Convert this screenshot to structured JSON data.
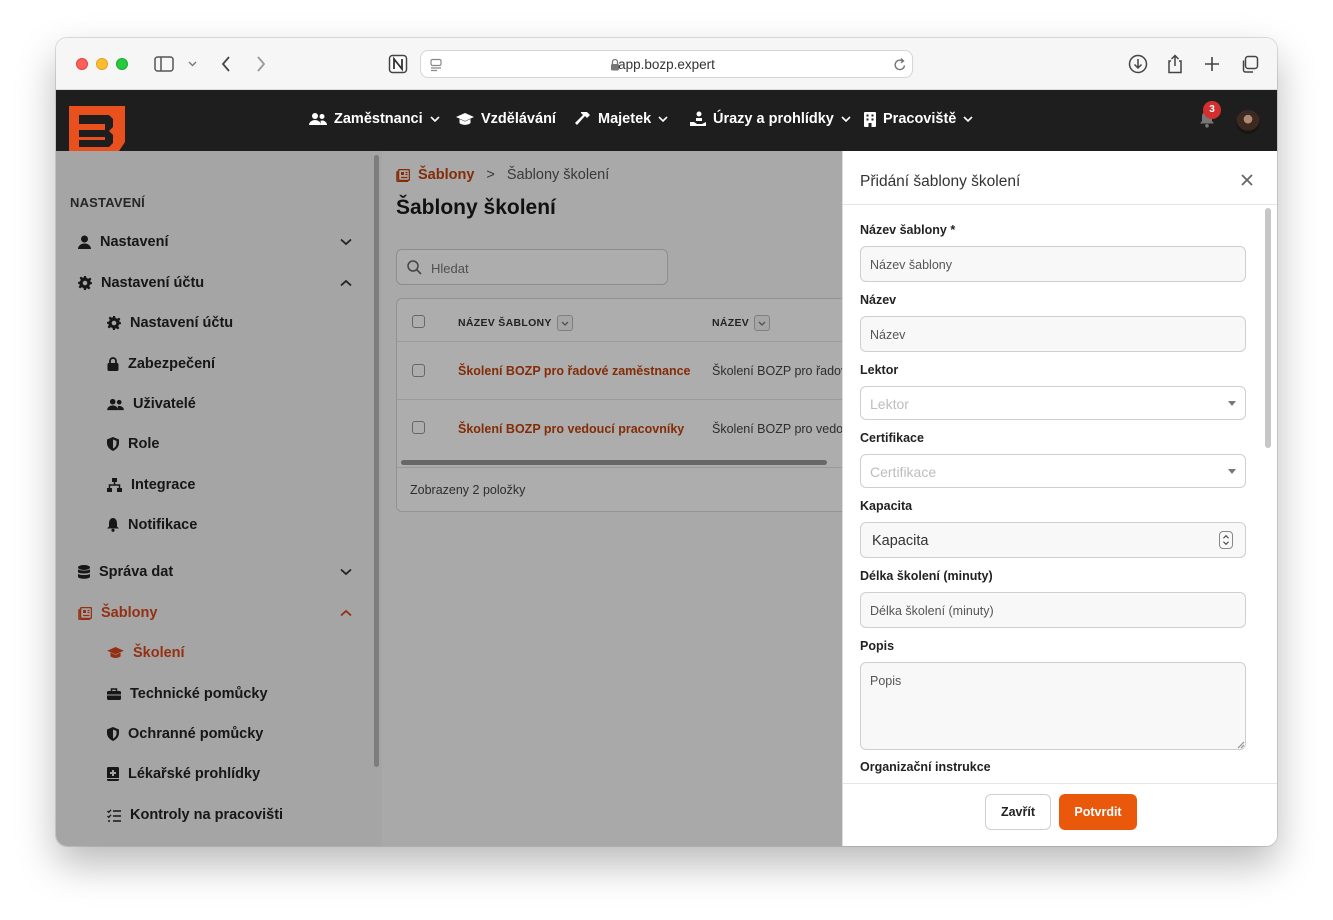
{
  "browser": {
    "url": "app.bozp.expert"
  },
  "nav": {
    "items": [
      {
        "label": "Zaměstnanci",
        "icon": "users-icon",
        "dropdown": true
      },
      {
        "label": "Vzdělávání",
        "icon": "graduation-cap-icon",
        "dropdown": false
      },
      {
        "label": "Majetek",
        "icon": "hammer-icon",
        "dropdown": true
      },
      {
        "label": "Úrazy a prohlídky",
        "icon": "injury-icon",
        "dropdown": true
      },
      {
        "label": "Pracoviště",
        "icon": "building-icon",
        "dropdown": true
      }
    ],
    "notifications_count": "3"
  },
  "sidebar": {
    "section_title": "NASTAVENÍ",
    "groups": [
      {
        "label": "Nastavení",
        "icon": "user-icon",
        "expanded": false
      },
      {
        "label": "Nastavení účtu",
        "icon": "gear-icon",
        "expanded": true
      },
      {
        "label": "Správa dat",
        "icon": "database-icon",
        "expanded": false
      },
      {
        "label": "Šablony",
        "icon": "template-icon",
        "expanded": true
      }
    ],
    "account_items": [
      {
        "label": "Nastavení účtu",
        "icon": "gear-icon"
      },
      {
        "label": "Zabezpečení",
        "icon": "lock-icon"
      },
      {
        "label": "Uživatelé",
        "icon": "users-icon"
      },
      {
        "label": "Role",
        "icon": "shield-icon"
      },
      {
        "label": "Integrace",
        "icon": "network-icon"
      },
      {
        "label": "Notifikace",
        "icon": "bell-icon"
      }
    ],
    "template_items": [
      {
        "label": "Školení",
        "icon": "graduation-cap-icon",
        "active": true
      },
      {
        "label": "Technické pomůcky",
        "icon": "toolbox-icon"
      },
      {
        "label": "Ochranné pomůcky",
        "icon": "shield-icon"
      },
      {
        "label": "Lékařské prohlídky",
        "icon": "medical-book-icon"
      },
      {
        "label": "Kontroly na pracovišti",
        "icon": "checklist-icon"
      }
    ]
  },
  "main": {
    "breadcrumb": {
      "parent": "Šablony",
      "separator": ">",
      "current": "Šablony školení"
    },
    "title": "Šablony školení",
    "search_placeholder": "Hledat",
    "table": {
      "columns": [
        "NÁZEV ŠABLONY",
        "NÁZEV"
      ],
      "rows": [
        {
          "template_name": "Školení BOZP pro řadové zaměstnance",
          "name": "Školení BOZP pro řadové"
        },
        {
          "template_name": "Školení BOZP pro vedoucí pracovníky",
          "name": "Školení BOZP pro vedouc"
        }
      ],
      "footer": "Zobrazeny 2 položky"
    }
  },
  "panel": {
    "title": "Přidání šablony školení",
    "fields": {
      "template_name": {
        "label": "Název šablony *",
        "placeholder": "Název šablony"
      },
      "name": {
        "label": "Název",
        "placeholder": "Název"
      },
      "lecturer": {
        "label": "Lektor",
        "placeholder": "Lektor"
      },
      "certification": {
        "label": "Certifikace",
        "placeholder": "Certifikace"
      },
      "capacity": {
        "label": "Kapacita",
        "placeholder": "Kapacita"
      },
      "duration": {
        "label": "Délka školení (minuty)",
        "placeholder": "Délka školení (minuty)"
      },
      "description": {
        "label": "Popis",
        "placeholder": "Popis"
      },
      "org_instructions": {
        "label": "Organizační instrukce"
      }
    },
    "buttons": {
      "close": "Zavřít",
      "confirm": "Potvrdit"
    }
  },
  "colors": {
    "accent": "#ea580c",
    "link": "#c2410c",
    "header_bg": "#1e1e1e",
    "badge": "#d32f2f"
  }
}
